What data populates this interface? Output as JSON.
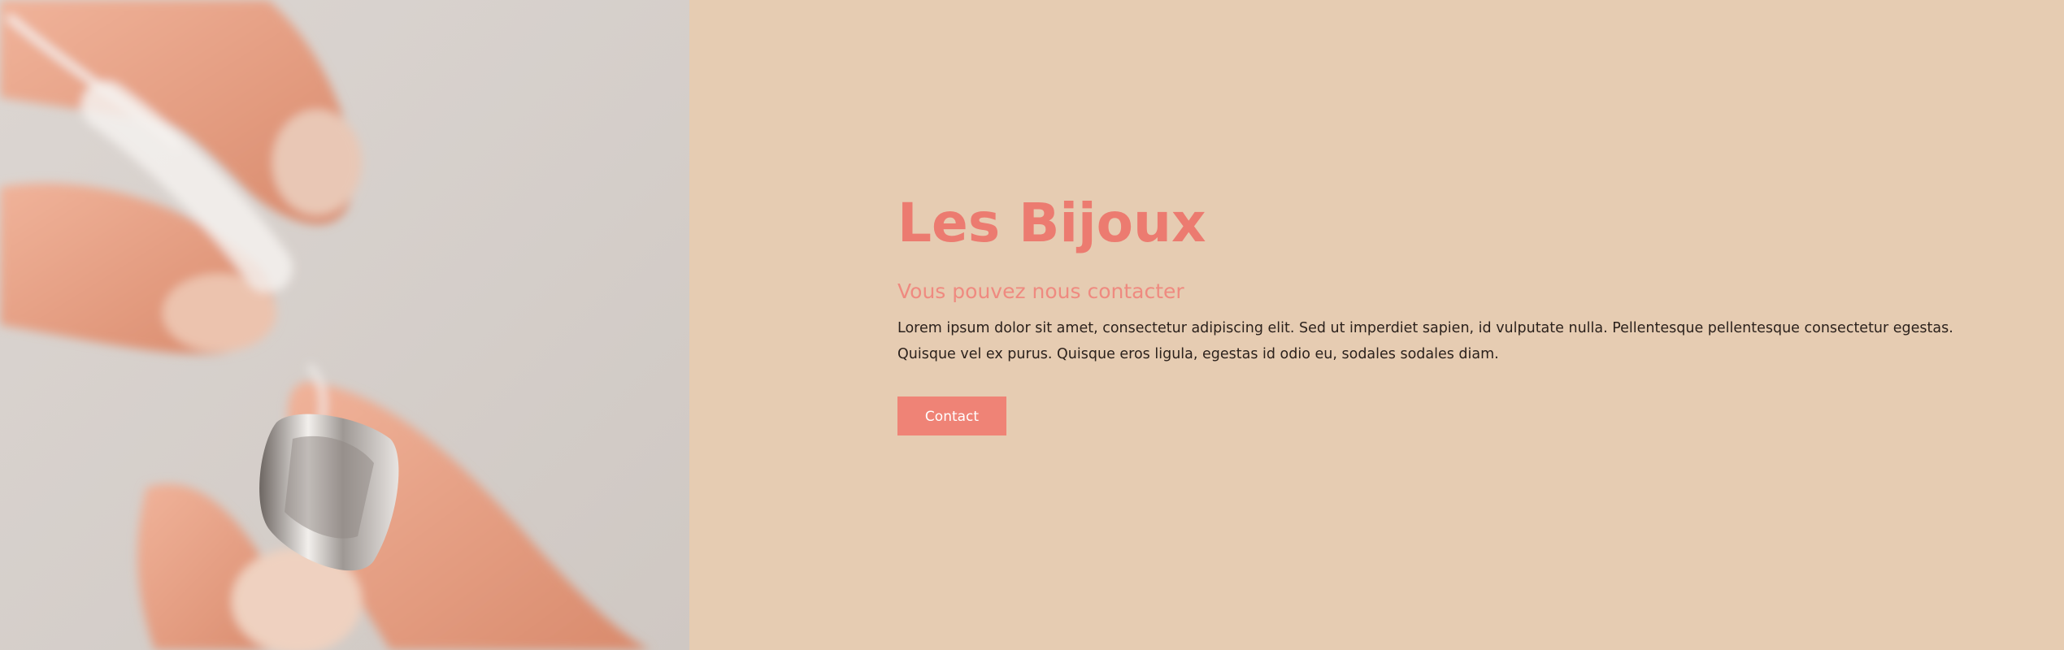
{
  "hero": {
    "title": "Les Bijoux",
    "subtitle": "Vous pouvez nous contacter",
    "body": "Lorem ipsum dolor sit amet, consectetur adipiscing elit. Sed ut imperdiet sapien, id vulputate nulla. Pellentesque pellentesque consectetur egestas. Quisque vel ex purus. Quisque eros ligula, egestas id odio eu, sodales sodales diam.",
    "button_label": "Contact"
  },
  "colors": {
    "background": "#e6ccb2",
    "accent": "#ec7b70",
    "button": "#ef8376",
    "text": "#2b211c"
  }
}
